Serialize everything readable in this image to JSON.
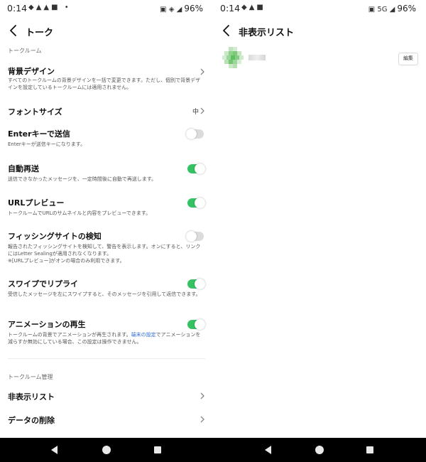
{
  "left_screen": {
    "status": {
      "time": "0:14",
      "battery": "96%"
    },
    "header": {
      "title": "トーク"
    },
    "section_chat_room": "トークルーム",
    "background_design": {
      "title": "背景デザイン",
      "desc": "すべてのトークルームの背景デザインを一括で変更できます。ただし、個別で背景デザインを設定しているトークルームには適用されません。"
    },
    "font_size": {
      "title": "フォントサイズ",
      "value": "中"
    },
    "enter_send": {
      "title": "Enterキーで送信",
      "desc": "Enterキーが送信キーになります。",
      "enabled": false
    },
    "auto_resend": {
      "title": "自動再送",
      "desc": "送信できなかったメッセージを、一定時間後に自動で再送します。",
      "enabled": true
    },
    "url_preview": {
      "title": "URLプレビュー",
      "desc": "トークルームでURLのサムネイルと内容をプレビューできます。",
      "enabled": true
    },
    "phishing": {
      "title": "フィッシングサイトの検知",
      "desc": "報告されたフィッシングサイトを検知して、警告を表示します。オンにすると、リンクにはLetter Sealingが適用されなくなります。",
      "note": "※[URLプレビュー]がオンの場合のみ利用できます。",
      "enabled": false
    },
    "swipe_reply": {
      "title": "スワイプでリプライ",
      "desc": "受信したメッセージを左にスワイプすると、そのメッセージを引用して返信できます。",
      "enabled": true
    },
    "animation": {
      "title": "アニメーションの再生",
      "desc_before": "トークルームの背景でアニメーションが再生されます。",
      "desc_link": "端末の設定",
      "desc_after": "でアニメーションを減らすか無効にしている場合、この設定は操作できません。",
      "enabled": true
    },
    "section_room_management": "トークルーム管理",
    "hidden_list": {
      "title": "非表示リスト"
    },
    "delete_data": {
      "title": "データの削除"
    }
  },
  "right_screen": {
    "status": {
      "time": "0:14",
      "network": "5G",
      "battery": "96%"
    },
    "header": {
      "title": "非表示リスト"
    },
    "edit_button": "編集"
  },
  "colors": {
    "toggle_on": "#35c263",
    "toggle_off": "#dcdcdc",
    "link": "#2c68d8",
    "navbar": "#000000"
  },
  "icons": [
    "back-arrow",
    "chevron-right",
    "nav-back-triangle",
    "nav-home-circle",
    "nav-recent-square"
  ]
}
